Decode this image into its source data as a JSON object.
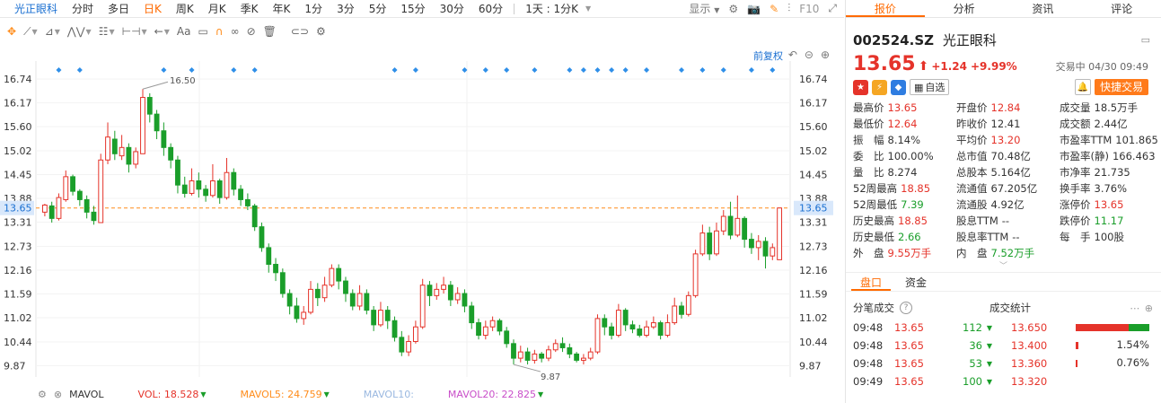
{
  "period_bar": {
    "stock_name": "光正眼科",
    "tabs": [
      "分时",
      "多日",
      "日K",
      "周K",
      "月K",
      "季K",
      "年K",
      "1分",
      "3分",
      "5分",
      "15分",
      "30分",
      "60分"
    ],
    "active_tab": "日K",
    "interval_select": "1天 : 1分K",
    "display_label": "显示",
    "f10_label": "F10"
  },
  "draw_toolbar": {
    "tools": [
      "move-icon",
      "line-icon",
      "channel-icon",
      "wave-icon",
      "fib-icon",
      "measure-icon",
      "arrow-icon",
      "text-icon",
      "comment-icon",
      "magnet-icon",
      "lock-icon",
      "hide-icon",
      "delete-icon",
      "link-icon",
      "settings-icon"
    ],
    "text_tool_label": "Aa"
  },
  "chart": {
    "adjust_label": "前复权",
    "price_current_label": "13.65",
    "y_ticks_left": [
      "16.74",
      "16.17",
      "15.60",
      "15.02",
      "14.45",
      "13.88",
      "13.31",
      "12.73",
      "12.16",
      "11.59",
      "11.02",
      "10.44",
      "9.87"
    ],
    "y_ticks_right": [
      "16.74",
      "16.17",
      "15.60",
      "15.02",
      "14.45",
      "13.88",
      "13.31",
      "12.73",
      "12.16",
      "11.59",
      "11.02",
      "10.44",
      "9.87"
    ],
    "high_annotation": "16.50",
    "low_annotation": "9.87"
  },
  "chart_data": {
    "type": "candlestick",
    "ylim": [
      9.6,
      17.0
    ],
    "current_price": 13.65,
    "max_label": 16.5,
    "min_label": 9.87,
    "candles": [
      [
        13.55,
        13.72,
        13.75,
        13.45
      ],
      [
        13.7,
        13.4,
        13.8,
        13.3
      ],
      [
        13.4,
        13.9,
        14.0,
        13.35
      ],
      [
        13.85,
        14.4,
        14.55,
        13.8
      ],
      [
        14.4,
        14.05,
        14.45,
        13.95
      ],
      [
        14.05,
        13.85,
        14.1,
        13.7
      ],
      [
        13.85,
        13.55,
        13.95,
        13.4
      ],
      [
        13.55,
        13.35,
        13.7,
        13.25
      ],
      [
        13.3,
        14.8,
        14.95,
        13.3
      ],
      [
        14.8,
        15.35,
        15.7,
        14.7
      ],
      [
        15.3,
        14.95,
        15.5,
        14.8
      ],
      [
        14.9,
        15.1,
        15.4,
        14.8
      ],
      [
        15.1,
        14.7,
        15.2,
        14.5
      ],
      [
        14.7,
        15.0,
        15.1,
        14.6
      ],
      [
        14.95,
        16.3,
        16.5,
        14.95
      ],
      [
        16.3,
        15.9,
        16.4,
        15.7
      ],
      [
        15.9,
        15.5,
        16.0,
        15.3
      ],
      [
        15.5,
        15.1,
        15.7,
        14.9
      ],
      [
        15.1,
        14.8,
        15.2,
        14.6
      ],
      [
        14.8,
        14.2,
        14.9,
        14.0
      ],
      [
        14.2,
        14.0,
        14.4,
        13.9
      ],
      [
        14.0,
        14.3,
        14.6,
        13.95
      ],
      [
        14.3,
        14.1,
        14.5,
        13.9
      ],
      [
        14.1,
        13.95,
        14.2,
        13.8
      ],
      [
        13.95,
        14.3,
        14.7,
        13.9
      ],
      [
        14.3,
        13.9,
        14.35,
        13.75
      ],
      [
        13.9,
        14.5,
        14.85,
        13.85
      ],
      [
        14.5,
        14.1,
        14.6,
        13.95
      ],
      [
        14.1,
        13.85,
        14.2,
        13.7
      ],
      [
        13.85,
        13.7,
        14.0,
        13.6
      ],
      [
        13.7,
        13.2,
        13.75,
        13.1
      ],
      [
        13.2,
        12.7,
        13.3,
        12.6
      ],
      [
        12.7,
        12.3,
        12.8,
        12.1
      ],
      [
        12.3,
        12.1,
        12.45,
        11.9
      ],
      [
        12.1,
        11.6,
        12.2,
        11.5
      ],
      [
        11.6,
        11.3,
        11.7,
        11.1
      ],
      [
        11.3,
        11.0,
        11.5,
        10.9
      ],
      [
        11.0,
        11.15,
        11.3,
        10.85
      ],
      [
        11.15,
        11.7,
        11.9,
        11.1
      ],
      [
        11.7,
        11.5,
        11.85,
        11.3
      ],
      [
        11.5,
        11.8,
        12.0,
        11.4
      ],
      [
        11.8,
        12.2,
        12.3,
        11.75
      ],
      [
        12.2,
        11.9,
        12.3,
        11.7
      ],
      [
        11.9,
        11.6,
        12.0,
        11.4
      ],
      [
        11.6,
        11.3,
        11.7,
        11.2
      ],
      [
        11.3,
        11.6,
        11.8,
        11.2
      ],
      [
        11.6,
        11.2,
        11.7,
        11.1
      ],
      [
        11.2,
        10.85,
        11.3,
        10.7
      ],
      [
        10.85,
        11.2,
        11.4,
        10.8
      ],
      [
        11.2,
        10.95,
        11.3,
        10.75
      ],
      [
        10.95,
        10.55,
        11.05,
        10.45
      ],
      [
        10.55,
        10.2,
        10.7,
        10.1
      ],
      [
        10.2,
        10.45,
        10.6,
        10.1
      ],
      [
        10.45,
        10.8,
        10.95,
        10.4
      ],
      [
        10.8,
        11.8,
        11.95,
        10.75
      ],
      [
        11.8,
        11.55,
        11.9,
        11.3
      ],
      [
        11.55,
        11.7,
        11.85,
        11.45
      ],
      [
        11.7,
        11.8,
        12.0,
        11.6
      ],
      [
        11.8,
        11.45,
        11.9,
        11.3
      ],
      [
        11.45,
        11.6,
        11.75,
        11.35
      ],
      [
        11.6,
        11.3,
        11.7,
        11.15
      ],
      [
        11.3,
        10.9,
        11.4,
        10.75
      ],
      [
        10.9,
        10.6,
        11.0,
        10.5
      ],
      [
        10.6,
        10.8,
        10.95,
        10.5
      ],
      [
        10.8,
        10.95,
        11.05,
        10.7
      ],
      [
        10.95,
        10.7,
        11.0,
        10.6
      ],
      [
        10.7,
        10.4,
        10.8,
        10.3
      ],
      [
        10.4,
        10.05,
        10.5,
        9.9
      ],
      [
        10.05,
        10.2,
        10.35,
        9.95
      ],
      [
        10.2,
        10.0,
        10.3,
        9.9
      ],
      [
        10.0,
        10.15,
        10.25,
        9.92
      ],
      [
        10.15,
        10.05,
        10.2,
        9.95
      ],
      [
        10.05,
        10.25,
        10.35,
        9.98
      ],
      [
        10.25,
        10.4,
        10.5,
        10.2
      ],
      [
        10.4,
        10.3,
        10.55,
        10.2
      ],
      [
        10.3,
        10.15,
        10.4,
        10.05
      ],
      [
        10.15,
        10.0,
        10.2,
        9.95
      ],
      [
        10.0,
        10.05,
        10.15,
        9.9
      ],
      [
        10.05,
        10.2,
        10.3,
        10.0
      ],
      [
        10.2,
        11.0,
        11.1,
        10.15
      ],
      [
        11.0,
        10.8,
        11.1,
        10.6
      ],
      [
        10.8,
        10.6,
        10.9,
        10.5
      ],
      [
        10.6,
        11.2,
        11.35,
        10.55
      ],
      [
        11.2,
        10.85,
        11.25,
        10.7
      ],
      [
        10.85,
        10.75,
        10.95,
        10.65
      ],
      [
        10.75,
        10.6,
        10.85,
        10.55
      ],
      [
        10.6,
        10.8,
        10.95,
        10.55
      ],
      [
        10.8,
        10.9,
        11.05,
        10.75
      ],
      [
        10.9,
        10.6,
        10.95,
        10.5
      ],
      [
        10.6,
        10.9,
        11.1,
        10.55
      ],
      [
        10.9,
        11.3,
        11.5,
        10.85
      ],
      [
        11.3,
        11.1,
        11.4,
        11.0
      ],
      [
        11.1,
        11.55,
        11.65,
        11.05
      ],
      [
        11.55,
        12.55,
        12.65,
        11.5
      ],
      [
        12.55,
        13.05,
        13.25,
        12.5
      ],
      [
        13.05,
        12.55,
        13.2,
        12.4
      ],
      [
        12.55,
        13.1,
        13.3,
        12.5
      ],
      [
        13.1,
        13.45,
        13.6,
        13.0
      ],
      [
        13.45,
        13.0,
        13.8,
        12.9
      ],
      [
        13.0,
        13.4,
        13.95,
        12.95
      ],
      [
        13.4,
        12.9,
        13.45,
        12.7
      ],
      [
        12.9,
        12.7,
        13.05,
        12.55
      ],
      [
        12.7,
        12.85,
        13.0,
        12.4
      ],
      [
        12.85,
        12.5,
        12.95,
        12.2
      ],
      [
        12.5,
        12.7,
        12.8,
        12.4
      ],
      [
        12.41,
        13.65,
        13.65,
        12.64
      ]
    ]
  },
  "vol_legend": {
    "label": "MAVOL",
    "vol": "VOL: 18.528",
    "mavol5": "MAVOL5: 24.759",
    "mavol10": "MAVOL10:",
    "mavol20": "MAVOL20: 22.825",
    "colors": {
      "vol": "#e5332a",
      "mavol5": "#ff8c1a",
      "mavol10": "#9ab8e0",
      "mavol20": "#c94fc9"
    }
  },
  "right_panel": {
    "tabs": [
      "报价",
      "分析",
      "资讯",
      "评论"
    ],
    "active_tab": "报价",
    "code": "002524.SZ",
    "name": "光正眼科",
    "price": "13.65",
    "change": "+1.24",
    "change_pct": "+9.99%",
    "status": "交易中 04/30 09:49",
    "add_watch": "自选",
    "quick_trade": "快捷交易",
    "stats": [
      {
        "k": "最高价",
        "v": "13.65",
        "c": "red"
      },
      {
        "k": "开盘价",
        "v": "12.84",
        "c": "red"
      },
      {
        "k": "成交量",
        "v": "18.5万手",
        "c": ""
      },
      {
        "k": "最低价",
        "v": "12.64",
        "c": "red"
      },
      {
        "k": "昨收价",
        "v": "12.41",
        "c": ""
      },
      {
        "k": "成交额",
        "v": "2.44亿",
        "c": ""
      },
      {
        "k": "振　幅",
        "v": "8.14%",
        "c": ""
      },
      {
        "k": "平均价",
        "v": "13.20",
        "c": "red"
      },
      {
        "k": "市盈率TTM",
        "v": "101.865",
        "c": ""
      },
      {
        "k": "委　比",
        "v": "100.00%",
        "c": ""
      },
      {
        "k": "总市值",
        "v": "70.48亿",
        "c": ""
      },
      {
        "k": "市盈率(静)",
        "v": "166.463",
        "c": ""
      },
      {
        "k": "量　比",
        "v": "8.274",
        "c": ""
      },
      {
        "k": "总股本",
        "v": "5.164亿",
        "c": ""
      },
      {
        "k": "市净率",
        "v": "21.735",
        "c": ""
      },
      {
        "k": "52周最高",
        "v": "18.85",
        "c": "red"
      },
      {
        "k": "流通值",
        "v": "67.205亿",
        "c": ""
      },
      {
        "k": "换手率",
        "v": "3.76%",
        "c": ""
      },
      {
        "k": "52周最低",
        "v": "7.39",
        "c": "green"
      },
      {
        "k": "流通股",
        "v": "4.92亿",
        "c": ""
      },
      {
        "k": "涨停价",
        "v": "13.65",
        "c": "red"
      },
      {
        "k": "历史最高",
        "v": "18.85",
        "c": "red"
      },
      {
        "k": "股息TTM",
        "v": "--",
        "c": ""
      },
      {
        "k": "跌停价",
        "v": "11.17",
        "c": "green"
      },
      {
        "k": "历史最低",
        "v": "2.66",
        "c": "green"
      },
      {
        "k": "股息率TTM",
        "v": "--",
        "c": ""
      },
      {
        "k": "每　手",
        "v": "100股",
        "c": ""
      },
      {
        "k": "外　盘",
        "v": "9.55万手",
        "c": "red"
      },
      {
        "k": "内　盘",
        "v": "7.52万手",
        "c": "green"
      },
      {
        "k": "",
        "v": "",
        "c": ""
      }
    ],
    "sub_tabs": [
      "盘口",
      "资金"
    ],
    "active_sub_tab": "盘口",
    "tick_title": "分笔成交",
    "stat_title": "成交统计",
    "ticks": [
      {
        "time": "09:48",
        "price": "13.65",
        "qty": "112",
        "stat_price": "13.650",
        "bar": 0.72,
        "bar2": 0.28,
        "pct": ""
      },
      {
        "time": "09:48",
        "price": "13.65",
        "qty": "36",
        "stat_price": "13.400",
        "bar": 0.04,
        "bar2": 0,
        "pct": "1.54%"
      },
      {
        "time": "09:48",
        "price": "13.65",
        "qty": "53",
        "stat_price": "13.360",
        "bar": 0.025,
        "bar2": 0,
        "pct": "0.76%"
      },
      {
        "time": "09:49",
        "price": "13.65",
        "qty": "100",
        "stat_price": "13.320",
        "bar": 0,
        "bar2": 0,
        "pct": ""
      }
    ]
  }
}
